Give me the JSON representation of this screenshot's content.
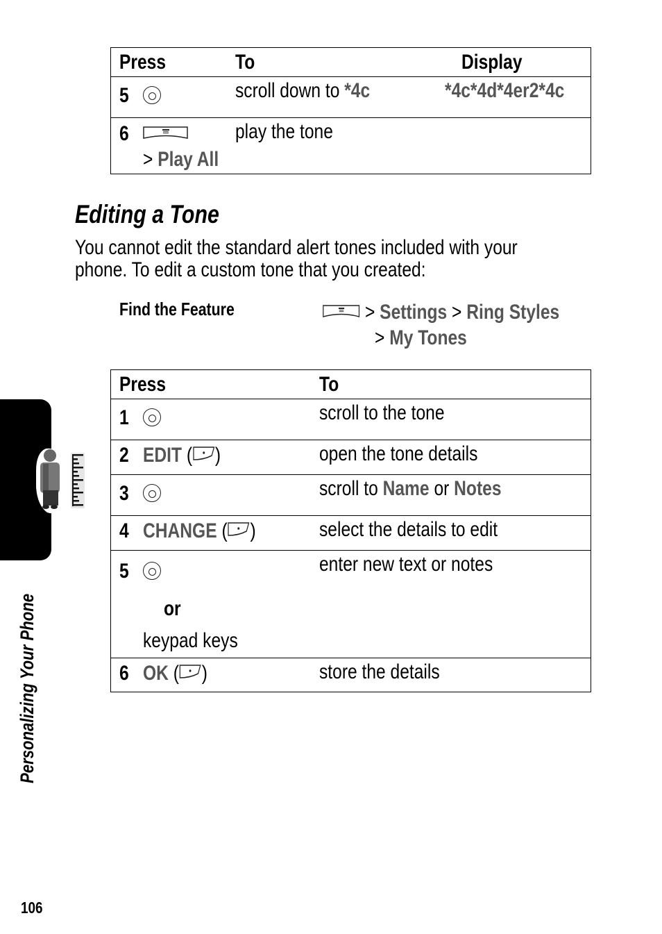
{
  "table1": {
    "headers": {
      "press": "Press",
      "to": "To",
      "display": "Display"
    },
    "rows": [
      {
        "num": "5",
        "press_icon": "nav-key-icon",
        "press_extra": "",
        "to_text": "scroll down to ",
        "to_highlight": "*4c",
        "display": "*4c*4d*4er2*4c"
      },
      {
        "num": "6",
        "press_icon": "menu-key-icon",
        "press_extra_prefix": "> ",
        "press_extra": "Play All",
        "to_text": "play the tone",
        "display": ""
      }
    ]
  },
  "section": {
    "heading": "Editing a Tone",
    "intro_line1": "You cannot edit the standard alert tones included with your",
    "intro_line2": "phone. To edit a custom tone that you created:"
  },
  "find_feature": {
    "label": "Find the Feature",
    "path": [
      {
        "sep": " > ",
        "item": "Settings"
      },
      {
        "sep": " > ",
        "item": "Ring Styles"
      },
      {
        "sep": "> ",
        "item": "My Tones"
      }
    ]
  },
  "table2": {
    "headers": {
      "press": "Press",
      "to": "To"
    },
    "rows": [
      {
        "num": "1",
        "press_label": "",
        "press_icon": "nav-key-icon",
        "to": "scroll to the tone"
      },
      {
        "num": "2",
        "press_label": "EDIT",
        "press_icon": "soft-key-icon",
        "to": "open the tone details"
      },
      {
        "num": "3",
        "press_label": "",
        "press_icon": "nav-key-icon",
        "to_prefix": "scroll to ",
        "to_h1": "Name",
        "to_mid": " or ",
        "to_h2": "Notes"
      },
      {
        "num": "4",
        "press_label": "CHANGE",
        "press_icon": "soft-key-icon",
        "to": "select the details to edit"
      },
      {
        "num": "5",
        "press_label": "",
        "press_icon": "nav-key-icon",
        "or": "or",
        "alt": "keypad keys",
        "to": "enter new text or notes"
      },
      {
        "num": "6",
        "press_label": "OK",
        "press_icon": "soft-key-icon",
        "to": "store the details"
      }
    ]
  },
  "sidebar": {
    "chapter": "Personalizing Your Phone"
  },
  "footer": {
    "page_number": "106"
  },
  "colors": {
    "highlight": "#555555",
    "tab": "#000000"
  }
}
